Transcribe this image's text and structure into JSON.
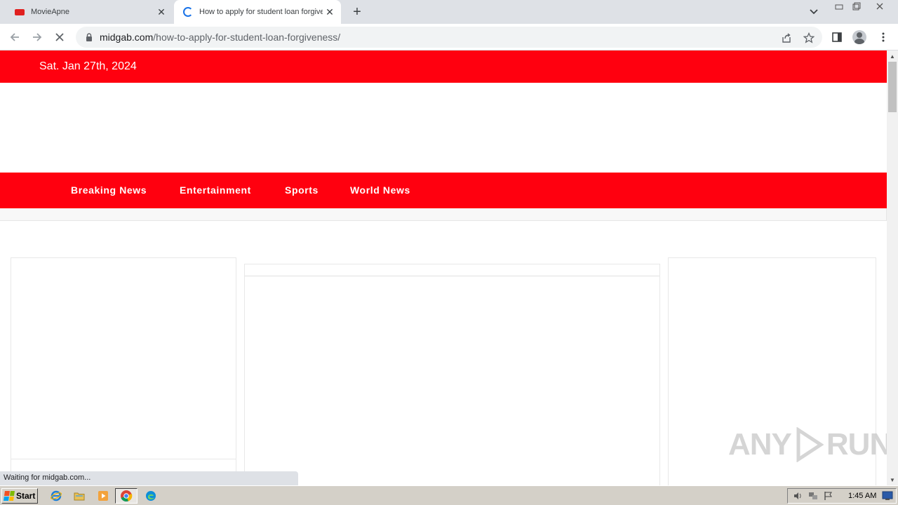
{
  "browser": {
    "tabs": [
      {
        "title": "MovieApne",
        "active": false
      },
      {
        "title": "How to apply for student loan forgiveness",
        "active": true
      }
    ],
    "url_host": "midgab.com",
    "url_path": "/how-to-apply-for-student-loan-forgiveness/",
    "status_text": "Waiting for midgab.com..."
  },
  "site": {
    "date": "Sat. Jan 27th, 2024",
    "nav": [
      {
        "label": "Breaking News"
      },
      {
        "label": "Entertainment"
      },
      {
        "label": "Sports"
      },
      {
        "label": "World News"
      }
    ],
    "accent_color": "#ff000f"
  },
  "watermark": {
    "left": "ANY",
    "right": "RUN"
  },
  "taskbar": {
    "start_label": "Start",
    "clock": "1:45 AM"
  }
}
